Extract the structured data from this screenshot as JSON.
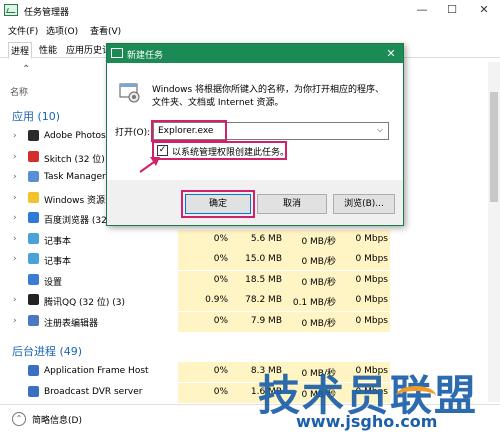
{
  "window": {
    "title": "任务管理器",
    "controls": {
      "minimize": "—",
      "maximize": "☐",
      "close": "✕"
    }
  },
  "menu": [
    "文件(F)",
    "选项(O)",
    "查看(V)"
  ],
  "tabs": [
    "进程",
    "性能",
    "应用历史记"
  ],
  "column_name": "名称",
  "sections": {
    "apps": "应用 (10)",
    "background": "后台进程 (49)"
  },
  "processes": [
    {
      "name": "Adobe Photos",
      "icon_color": "#2b2b2b",
      "expandable": true
    },
    {
      "name": "Skitch (32 位)",
      "icon_color": "#d62c2c",
      "expandable": true
    },
    {
      "name": "Task Manager",
      "icon_color": "#5a8fd6",
      "expandable": true
    },
    {
      "name": "Windows 资源",
      "icon_color": "#f2c12e",
      "expandable": true
    },
    {
      "name": "百度浏览器 (32",
      "icon_color": "#2f7ad6",
      "expandable": true
    },
    {
      "name": "记事本",
      "icon_color": "#4aa3d8",
      "expandable": true,
      "cpu": "0%",
      "mem": "5.6 MB",
      "disk": "0 MB/秒",
      "net": "0 Mbps"
    },
    {
      "name": "记事本",
      "icon_color": "#4aa3d8",
      "expandable": true,
      "cpu": "0%",
      "mem": "15.0 MB",
      "disk": "0 MB/秒",
      "net": "0 Mbps"
    },
    {
      "name": "设置",
      "icon_color": "#3a7bd5",
      "expandable": false,
      "cpu": "0%",
      "mem": "18.5 MB",
      "disk": "0 MB/秒",
      "net": "0 Mbps"
    },
    {
      "name": "腾讯QQ (32 位) (3)",
      "icon_color": "#222222",
      "expandable": true,
      "cpu": "0.9%",
      "mem": "78.2 MB",
      "disk": "0.1 MB/秒",
      "net": "0 Mbps"
    },
    {
      "name": "注册表编辑器",
      "icon_color": "#4a78c2",
      "expandable": true,
      "cpu": "0%",
      "mem": "7.9 MB",
      "disk": "0 MB/秒",
      "net": "0 Mbps"
    }
  ],
  "background_processes": [
    {
      "name": "Application Frame Host",
      "icon_color": "#3a6fc4",
      "cpu": "0%",
      "mem": "8.3 MB",
      "disk": "0 MB/秒",
      "net": "0 Mbps"
    },
    {
      "name": "Broadcast DVR server",
      "icon_color": "#3a6fc4",
      "cpu": "0%",
      "mem": "1.6 MB",
      "disk": "0 MB/秒",
      "net": "0 Mbps"
    }
  ],
  "bottom": {
    "fewer_details": "简略信息(D)"
  },
  "dialog": {
    "title": "新建任务",
    "close": "✕",
    "description": "Windows 将根据你所键入的名称，为你打开相应的程序、文件夹、文档或 Internet 资源。",
    "open_label": "打开(O):",
    "open_value": "Explorer.exe",
    "checkbox_label": "以系统管理权限创建此任务。",
    "checkbox_checked": true,
    "buttons": {
      "ok": "确定",
      "cancel": "取消",
      "browse": "浏览(B)..."
    }
  },
  "watermark": {
    "text": "技术员联盟",
    "url": "www.jsgho.com"
  },
  "colors": {
    "section": "#1a63b5",
    "highlight": "#d0216a",
    "dialog_title": "#1b8a55",
    "usage_bg": "#fff4c4"
  }
}
